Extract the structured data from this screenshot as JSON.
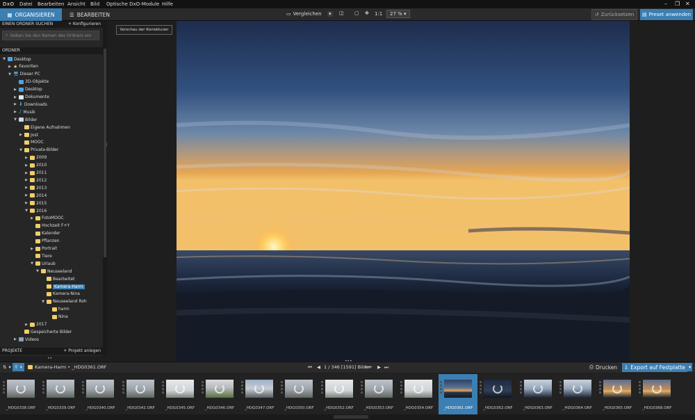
{
  "menubar": {
    "logo": "DxO",
    "items": [
      "Datei",
      "Bearbeiten",
      "Ansicht",
      "Bild",
      "Optische DxO-Module",
      "Hilfe"
    ]
  },
  "toolbar": {
    "tab_organize": "ORGANISIEREN",
    "tab_edit": "BEARBEITEN",
    "compare_label": "Vergleichen",
    "ratio_label": "1:1",
    "zoom_value": "27 %",
    "reset_label": "Zurücksetzen",
    "preset_label": "Preset anwenden"
  },
  "left_panel": {
    "search_header": "EINEN ORDNER SUCHEN",
    "configure_label": "+ Konfigurieren",
    "search_placeholder": "Geben Sie den Namen des Ordners ein",
    "folders_header": "ORDNER",
    "projects_header": "PROJEKTE",
    "create_project_label": "+ Projekt anlegen"
  },
  "tree": [
    {
      "label": "Desktop",
      "indent": 0,
      "arrow": "down",
      "icon": "folder-blue"
    },
    {
      "label": "Favoriten",
      "indent": 1,
      "arrow": "right",
      "icon": "star"
    },
    {
      "label": "Dieser PC",
      "indent": 1,
      "arrow": "down",
      "icon": "pc"
    },
    {
      "label": "3D-Objekte",
      "indent": 2,
      "arrow": "none",
      "icon": "folder-blue"
    },
    {
      "label": "Desktop",
      "indent": 2,
      "arrow": "right",
      "icon": "folder-blue"
    },
    {
      "label": "Dokumente",
      "indent": 2,
      "arrow": "right",
      "icon": "folder-doc"
    },
    {
      "label": "Downloads",
      "indent": 2,
      "arrow": "right",
      "icon": "download"
    },
    {
      "label": "Musik",
      "indent": 2,
      "arrow": "right",
      "icon": "music"
    },
    {
      "label": "Bilder",
      "indent": 2,
      "arrow": "down",
      "icon": "folder-pic"
    },
    {
      "label": "Eigene Aufnahmen",
      "indent": 3,
      "arrow": "none",
      "icon": "folder"
    },
    {
      "label": "Jost",
      "indent": 3,
      "arrow": "right",
      "icon": "folder"
    },
    {
      "label": "MOOC",
      "indent": 3,
      "arrow": "none",
      "icon": "folder"
    },
    {
      "label": "Private-Bilder",
      "indent": 3,
      "arrow": "down",
      "icon": "folder"
    },
    {
      "label": "2009",
      "indent": 4,
      "arrow": "right",
      "icon": "folder"
    },
    {
      "label": "2010",
      "indent": 4,
      "arrow": "right",
      "icon": "folder"
    },
    {
      "label": "2011",
      "indent": 4,
      "arrow": "right",
      "icon": "folder"
    },
    {
      "label": "2012",
      "indent": 4,
      "arrow": "right",
      "icon": "folder"
    },
    {
      "label": "2013",
      "indent": 4,
      "arrow": "right",
      "icon": "folder"
    },
    {
      "label": "2014",
      "indent": 4,
      "arrow": "right",
      "icon": "folder"
    },
    {
      "label": "2015",
      "indent": 4,
      "arrow": "right",
      "icon": "folder"
    },
    {
      "label": "2016",
      "indent": 4,
      "arrow": "down",
      "icon": "folder"
    },
    {
      "label": "FotoMOOC",
      "indent": 5,
      "arrow": "right",
      "icon": "folder"
    },
    {
      "label": "Hochzeit F+Y",
      "indent": 5,
      "arrow": "none",
      "icon": "folder"
    },
    {
      "label": "Kalender",
      "indent": 5,
      "arrow": "none",
      "icon": "folder"
    },
    {
      "label": "Pflanzen",
      "indent": 5,
      "arrow": "none",
      "icon": "folder"
    },
    {
      "label": "Portrait",
      "indent": 5,
      "arrow": "right",
      "icon": "folder"
    },
    {
      "label": "Tiere",
      "indent": 5,
      "arrow": "none",
      "icon": "folder"
    },
    {
      "label": "Urlaub",
      "indent": 5,
      "arrow": "down",
      "icon": "folder"
    },
    {
      "label": "Neuseeland",
      "indent": 6,
      "arrow": "down",
      "icon": "folder"
    },
    {
      "label": "Bearbeitet",
      "indent": 7,
      "arrow": "none",
      "icon": "folder"
    },
    {
      "label": "Kamera-Harm",
      "indent": 7,
      "arrow": "none",
      "icon": "folder",
      "selected": true
    },
    {
      "label": "Kamera-Nina",
      "indent": 7,
      "arrow": "none",
      "icon": "folder"
    },
    {
      "label": "Neuseeland Roh",
      "indent": 7,
      "arrow": "down",
      "icon": "folder"
    },
    {
      "label": "harm",
      "indent": 8,
      "arrow": "none",
      "icon": "folder"
    },
    {
      "label": "Nina",
      "indent": 8,
      "arrow": "none",
      "icon": "folder"
    },
    {
      "label": "2017",
      "indent": 4,
      "arrow": "right",
      "icon": "folder"
    },
    {
      "label": "Gespeicherte Bilder",
      "indent": 3,
      "arrow": "none",
      "icon": "folder"
    },
    {
      "label": "Videos",
      "indent": 2,
      "arrow": "right",
      "icon": "folder-video"
    }
  ],
  "viewer": {
    "preview_label": "Vorschau der Korrekturen"
  },
  "filmstrip_bar": {
    "breadcrumb": "Kamera-Harm  •  _HDG0361.ORF",
    "counter": "1 / 346 [1591] Bilder",
    "print_label": "Drucken",
    "export_label": "Export auf Festplatte"
  },
  "thumbnails": [
    {
      "label": "_HDG0338.ORF",
      "tone": "gray"
    },
    {
      "label": "_HDG0339.ORF",
      "tone": "gray"
    },
    {
      "label": "_HDG0340.ORF",
      "tone": "gray"
    },
    {
      "label": "_HDG0342.ORF",
      "tone": "gray"
    },
    {
      "label": "_HDG0345.ORF",
      "tone": "light"
    },
    {
      "label": "_HDG0346.ORF",
      "tone": "green"
    },
    {
      "label": "_HDG0347.ORF",
      "tone": "bluegray"
    },
    {
      "label": "_HDG0350.ORF",
      "tone": "gray"
    },
    {
      "label": "_HDG0352.ORF",
      "tone": "light"
    },
    {
      "label": "_HDG0353.ORF",
      "tone": "gray"
    },
    {
      "label": "_HDG0354.ORF",
      "tone": "light"
    },
    {
      "label": "_HDG0361.ORF",
      "tone": "sunset",
      "selected": true
    },
    {
      "label": "_HDG0362.ORF",
      "tone": "dark"
    },
    {
      "label": "_HDG0363.ORF",
      "tone": "dusk"
    },
    {
      "label": "_HDG0364.ORF",
      "tone": "dusk"
    },
    {
      "label": "_HDG0365.ORF",
      "tone": "sunset2"
    },
    {
      "label": "_HDG0368.ORF",
      "tone": "sunset2"
    }
  ],
  "colors": {
    "accent": "#3b7fb3",
    "folder": "#f0cd6a"
  }
}
